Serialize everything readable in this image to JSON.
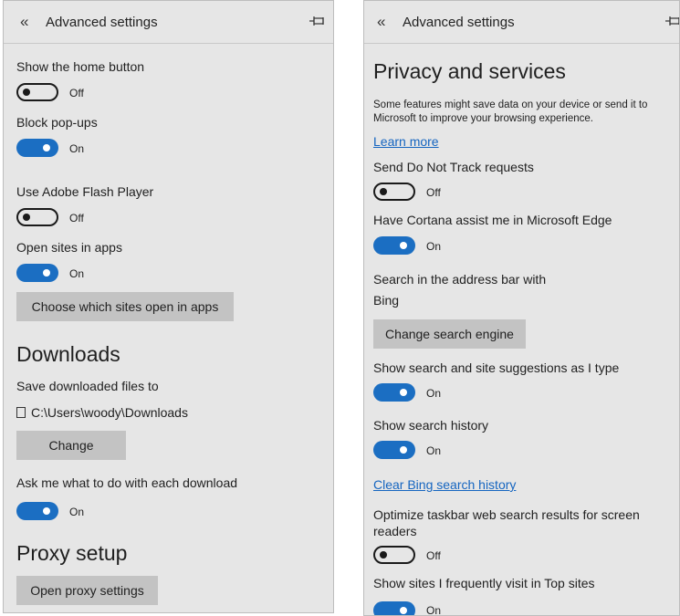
{
  "left": {
    "header": {
      "back_glyph": "«",
      "title": "Advanced settings",
      "pin_icon": "pin-icon"
    },
    "home_button": {
      "label": "Show the home button",
      "state": "Off"
    },
    "popups": {
      "label": "Block pop-ups",
      "state": "On"
    },
    "flash": {
      "label": "Use Adobe Flash Player",
      "state": "Off"
    },
    "apps": {
      "label": "Open sites in apps",
      "state": "On",
      "button": "Choose which sites open in apps"
    },
    "downloads": {
      "title": "Downloads",
      "save_label": "Save downloaded files to",
      "path": "C:\\Users\\woody\\Downloads",
      "change_button": "Change",
      "ask_label": "Ask me what to do with each download",
      "ask_state": "On"
    },
    "proxy": {
      "title": "Proxy setup",
      "button": "Open proxy settings"
    }
  },
  "right": {
    "header": {
      "back_glyph": "«",
      "title": "Advanced settings",
      "pin_icon": "pin-icon"
    },
    "privacy": {
      "title": "Privacy and services",
      "description": "Some features might save data on your device or send it to Microsoft to improve your browsing experience.",
      "learn_more": "Learn more"
    },
    "dnt": {
      "label": "Send Do Not Track requests",
      "state": "Off"
    },
    "cortana": {
      "label": "Have Cortana assist me in Microsoft Edge",
      "state": "On"
    },
    "search": {
      "label": "Search in the address bar with",
      "engine": "Bing",
      "button": "Change search engine"
    },
    "suggestions": {
      "label": "Show search and site suggestions as I type",
      "state": "On"
    },
    "history": {
      "label": "Show search history",
      "state": "On",
      "clear_link": "Clear Bing search history"
    },
    "optimize": {
      "label": "Optimize taskbar web search results for screen readers",
      "state": "Off"
    },
    "top_sites": {
      "label": "Show sites I frequently visit in Top sites",
      "state": "On"
    }
  },
  "colors": {
    "panel_bg": "#e6e6e6",
    "toggle_on": "#1b6ec2",
    "link": "#1565c0",
    "button_bg": "#c3c3c3"
  }
}
